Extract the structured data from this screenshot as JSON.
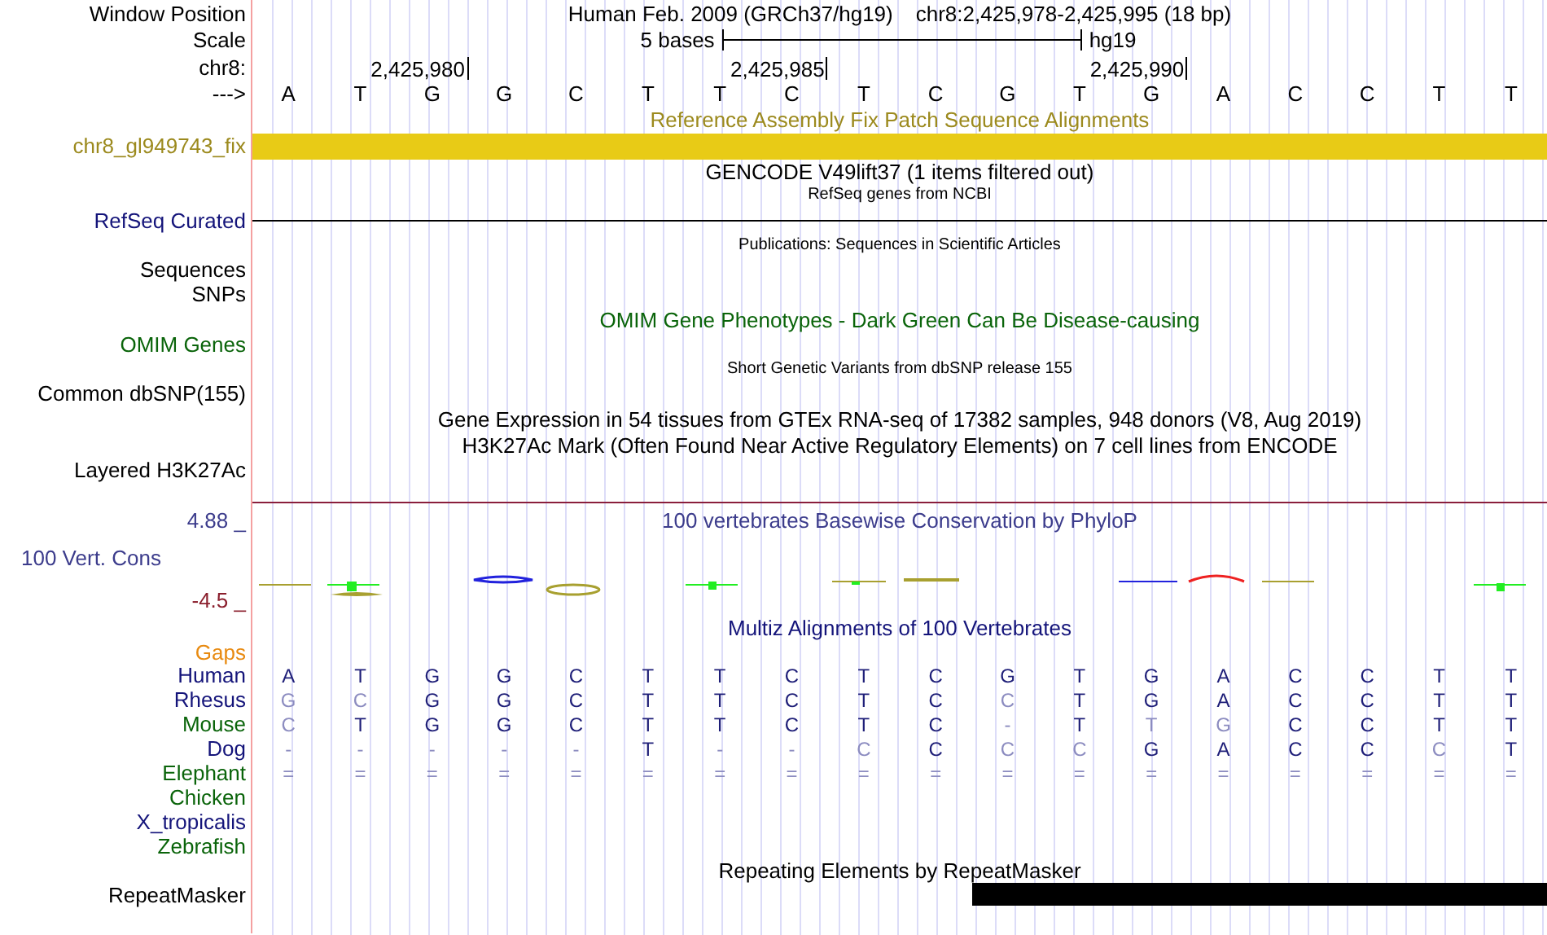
{
  "header": {
    "position_label": "Window Position",
    "assembly": "Human Feb. 2009 (GRCh37/hg19)",
    "range": "chr8:2,425,978-2,425,995 (18 bp)",
    "scale_label": "Scale",
    "scale_text": "5 bases",
    "scale_db": "hg19",
    "chrom_label": "chr8:",
    "strand_label": "--->"
  },
  "bases": [
    {
      "base": "A"
    },
    {
      "base": "T"
    },
    {
      "base": "G",
      "tick": "2,425,980"
    },
    {
      "base": "G"
    },
    {
      "base": "C"
    },
    {
      "base": "T"
    },
    {
      "base": "T"
    },
    {
      "base": "C",
      "tick": "2,425,985"
    },
    {
      "base": "T"
    },
    {
      "base": "C"
    },
    {
      "base": "G"
    },
    {
      "base": "T"
    },
    {
      "base": "G",
      "tick": "2,425,990"
    },
    {
      "base": "A"
    },
    {
      "base": "C"
    },
    {
      "base": "C"
    },
    {
      "base": "T"
    },
    {
      "base": "T"
    }
  ],
  "tracks": [
    {
      "kind": "title",
      "text": "Reference Assembly Fix Patch Sequence Alignments",
      "color": "#9c8a1e"
    },
    {
      "kind": "bar",
      "label": "chr8_gl949743_fix",
      "color": "#9c8a1e"
    },
    {
      "kind": "title",
      "text": "GENCODE V49lift37 (1 items filtered out)",
      "color": "#000000"
    },
    {
      "kind": "subtitle",
      "text": "RefSeq genes from NCBI",
      "color": "#000000"
    },
    {
      "kind": "line",
      "label": "RefSeq Curated",
      "color": "#14147a"
    },
    {
      "kind": "subtitle",
      "text": "Publications: Sequences in Scientific Articles",
      "color": "#000000"
    },
    {
      "kind": "label",
      "label": "Sequences",
      "color": "#000000"
    },
    {
      "kind": "label",
      "label": "SNPs",
      "color": "#000000"
    },
    {
      "kind": "title",
      "text": "OMIM Gene Phenotypes - Dark Green Can Be Disease-causing",
      "color": "#0a640a"
    },
    {
      "kind": "label",
      "label": "OMIM Genes",
      "color": "#0a640a"
    },
    {
      "kind": "subtitle",
      "text": "Short Genetic Variants from dbSNP release 155",
      "color": "#000000"
    },
    {
      "kind": "label",
      "label": "Common dbSNP(155)",
      "color": "#000000"
    },
    {
      "kind": "title",
      "text": "Gene Expression in 54 tissues from GTEx RNA-seq of 17382 samples, 948 donors (V8, Aug 2019)",
      "color": "#000000"
    },
    {
      "kind": "title",
      "text": "H3K27Ac Mark (Often Found Near Active Regulatory Elements) on 7 cell lines from ENCODE",
      "color": "#000000"
    },
    {
      "kind": "label",
      "label": "Layered H3K27Ac",
      "color": "#000000"
    }
  ],
  "conservation": {
    "title": "100 vertebrates Basewise Conservation by PhyloP",
    "label": "100 Vert. Cons",
    "max": "4.88 _",
    "min": "-4.5 _"
  },
  "multiz": {
    "title": "Multiz Alignments of 100 Vertebrates",
    "gaps_label": "Gaps",
    "species": [
      {
        "name": "Human",
        "color": "#14147a",
        "bases": [
          {
            "base": "A",
            "dim": false
          },
          {
            "base": "T",
            "dim": false
          },
          {
            "base": "G",
            "dim": false
          },
          {
            "base": "G",
            "dim": false
          },
          {
            "base": "C",
            "dim": false
          },
          {
            "base": "T",
            "dim": false
          },
          {
            "base": "T",
            "dim": false
          },
          {
            "base": "C",
            "dim": false
          },
          {
            "base": "T",
            "dim": false
          },
          {
            "base": "C",
            "dim": false
          },
          {
            "base": "G",
            "dim": false
          },
          {
            "base": "T",
            "dim": false
          },
          {
            "base": "G",
            "dim": false
          },
          {
            "base": "A",
            "dim": false
          },
          {
            "base": "C",
            "dim": false
          },
          {
            "base": "C",
            "dim": false
          },
          {
            "base": "T",
            "dim": false
          },
          {
            "base": "T",
            "dim": false
          }
        ]
      },
      {
        "name": "Rhesus",
        "color": "#14147a",
        "bases": [
          {
            "base": "G",
            "dim": true
          },
          {
            "base": "C",
            "dim": true
          },
          {
            "base": "G",
            "dim": false
          },
          {
            "base": "G",
            "dim": false
          },
          {
            "base": "C",
            "dim": false
          },
          {
            "base": "T",
            "dim": false
          },
          {
            "base": "T",
            "dim": false
          },
          {
            "base": "C",
            "dim": false
          },
          {
            "base": "T",
            "dim": false
          },
          {
            "base": "C",
            "dim": false
          },
          {
            "base": "C",
            "dim": true
          },
          {
            "base": "T",
            "dim": false
          },
          {
            "base": "G",
            "dim": false
          },
          {
            "base": "A",
            "dim": false
          },
          {
            "base": "C",
            "dim": false
          },
          {
            "base": "C",
            "dim": false
          },
          {
            "base": "T",
            "dim": false
          },
          {
            "base": "T",
            "dim": false
          }
        ]
      },
      {
        "name": "Mouse",
        "color": "#0a640a",
        "bases": [
          {
            "base": "C",
            "dim": true
          },
          {
            "base": "T",
            "dim": false
          },
          {
            "base": "G",
            "dim": false
          },
          {
            "base": "G",
            "dim": false
          },
          {
            "base": "C",
            "dim": false
          },
          {
            "base": "T",
            "dim": false
          },
          {
            "base": "T",
            "dim": false
          },
          {
            "base": "C",
            "dim": false
          },
          {
            "base": "T",
            "dim": false
          },
          {
            "base": "C",
            "dim": false
          },
          {
            "base": "-",
            "dim": true
          },
          {
            "base": "T",
            "dim": false
          },
          {
            "base": "T",
            "dim": true
          },
          {
            "base": "G",
            "dim": true
          },
          {
            "base": "C",
            "dim": false
          },
          {
            "base": "C",
            "dim": false
          },
          {
            "base": "T",
            "dim": false
          },
          {
            "base": "T",
            "dim": false
          }
        ]
      },
      {
        "name": "Dog",
        "color": "#14147a",
        "bases": [
          {
            "base": "-",
            "dim": true
          },
          {
            "base": "-",
            "dim": true
          },
          {
            "base": "-",
            "dim": true
          },
          {
            "base": "-",
            "dim": true
          },
          {
            "base": "-",
            "dim": true
          },
          {
            "base": "T",
            "dim": false
          },
          {
            "base": "-",
            "dim": true
          },
          {
            "base": "-",
            "dim": true
          },
          {
            "base": "C",
            "dim": true
          },
          {
            "base": "C",
            "dim": false
          },
          {
            "base": "C",
            "dim": true
          },
          {
            "base": "C",
            "dim": true
          },
          {
            "base": "G",
            "dim": false
          },
          {
            "base": "A",
            "dim": false
          },
          {
            "base": "C",
            "dim": false
          },
          {
            "base": "C",
            "dim": false
          },
          {
            "base": "C",
            "dim": true
          },
          {
            "base": "T",
            "dim": false
          }
        ]
      },
      {
        "name": "Elephant",
        "color": "#0a640a",
        "bases": [
          {
            "base": "=",
            "dim": true
          },
          {
            "base": "=",
            "dim": true
          },
          {
            "base": "=",
            "dim": true
          },
          {
            "base": "=",
            "dim": true
          },
          {
            "base": "=",
            "dim": true
          },
          {
            "base": "=",
            "dim": true
          },
          {
            "base": "=",
            "dim": true
          },
          {
            "base": "=",
            "dim": true
          },
          {
            "base": "=",
            "dim": true
          },
          {
            "base": "=",
            "dim": true
          },
          {
            "base": "=",
            "dim": true
          },
          {
            "base": "=",
            "dim": true
          },
          {
            "base": "=",
            "dim": true
          },
          {
            "base": "=",
            "dim": true
          },
          {
            "base": "=",
            "dim": true
          },
          {
            "base": "=",
            "dim": true
          },
          {
            "base": "=",
            "dim": true
          },
          {
            "base": "=",
            "dim": true
          }
        ]
      },
      {
        "name": "Chicken",
        "color": "#0a640a"
      },
      {
        "name": "X_tropicalis",
        "color": "#14147a"
      },
      {
        "name": "Zebrafish",
        "color": "#0a640a"
      }
    ]
  },
  "repeatmasker": {
    "title": "Repeating Elements by RepeatMasker",
    "label": "RepeatMasker"
  }
}
